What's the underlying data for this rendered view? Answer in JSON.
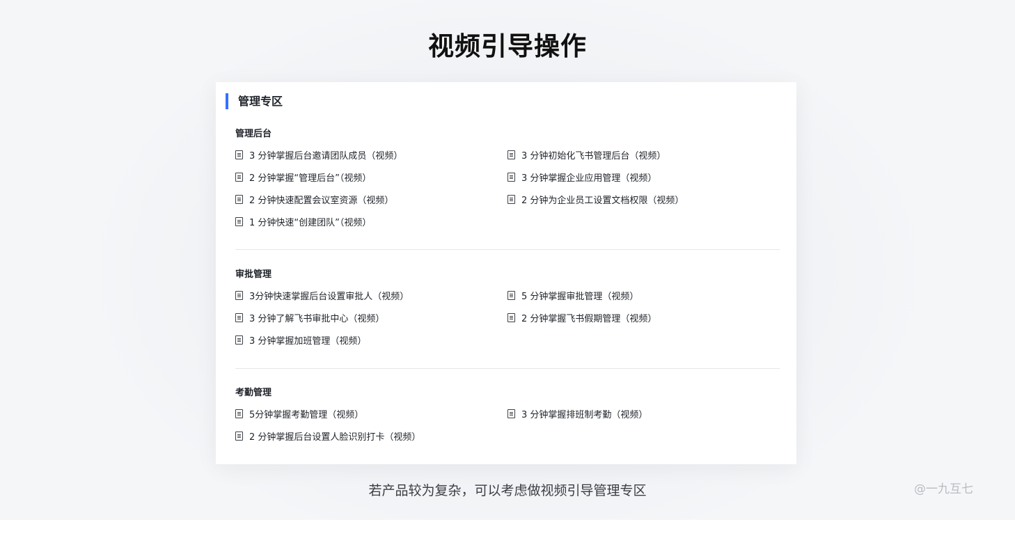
{
  "page": {
    "title": "视频引导操作",
    "caption": "若产品较为复杂，可以考虑做视频引导管理专区",
    "watermark": "@一九互七"
  },
  "card": {
    "zone_title": "管理专区",
    "accent_color": "#3370ff",
    "sections": [
      {
        "title": "管理后台",
        "links": [
          {
            "label": "3 分钟掌握后台邀请团队成员（视频）",
            "icon": "document-icon"
          },
          {
            "label": "3 分钟初始化飞书管理后台（视频）",
            "icon": "document-icon"
          },
          {
            "label": "2 分钟掌握“管理后台”（视频）",
            "icon": "document-icon"
          },
          {
            "label": "3 分钟掌握企业应用管理（视频）",
            "icon": "document-icon"
          },
          {
            "label": "2 分钟快速配置会议室资源（视频）",
            "icon": "document-icon"
          },
          {
            "label": "2 分钟为企业员工设置文档权限（视频）",
            "icon": "document-icon"
          },
          {
            "label": "1 分钟快速“创建团队”（视频）",
            "icon": "document-icon"
          }
        ]
      },
      {
        "title": "审批管理",
        "links": [
          {
            "label": "3分钟快速掌握后台设置审批人（视频）",
            "icon": "document-icon"
          },
          {
            "label": "5 分钟掌握审批管理（视频）",
            "icon": "document-icon"
          },
          {
            "label": "3 分钟了解飞书审批中心（视频）",
            "icon": "document-icon"
          },
          {
            "label": "2 分钟掌握飞书假期管理（视频）",
            "icon": "document-icon"
          },
          {
            "label": "3 分钟掌握加班管理（视频）",
            "icon": "document-icon"
          }
        ]
      },
      {
        "title": "考勤管理",
        "links": [
          {
            "label": "5分钟掌握考勤管理（视频）",
            "icon": "document-icon"
          },
          {
            "label": "3 分钟掌握排班制考勤（视频）",
            "icon": "document-icon"
          },
          {
            "label": "2 分钟掌握后台设置人脸识别打卡（视频）",
            "icon": "document-icon"
          }
        ]
      }
    ]
  }
}
